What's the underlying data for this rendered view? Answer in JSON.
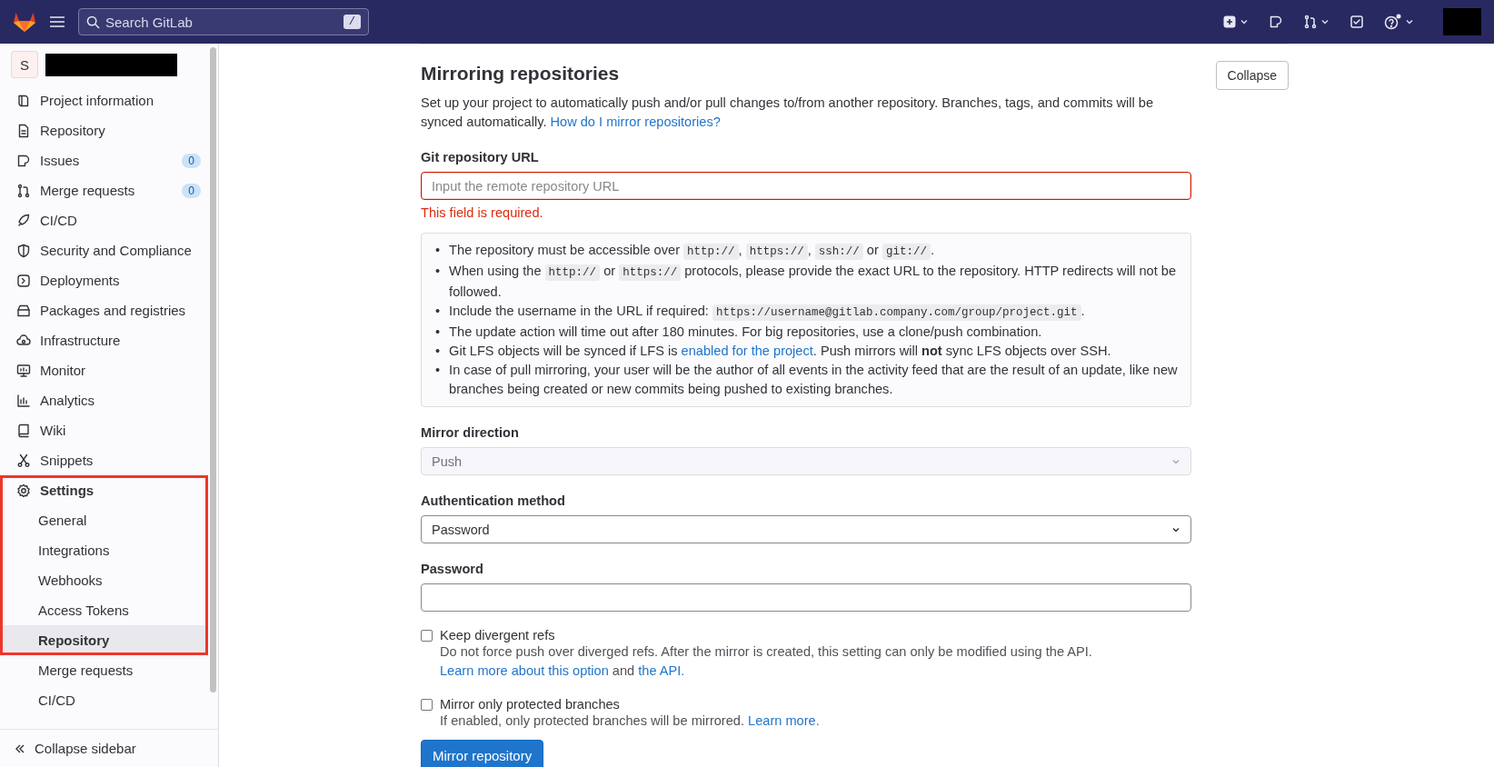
{
  "topbar": {
    "search": {
      "placeholder": "Search GitLab",
      "shortcut": "/"
    }
  },
  "sidebar": {
    "project_initial": "S",
    "items": [
      {
        "label": "Project information",
        "selected": false,
        "highlighted": false
      },
      {
        "label": "Repository",
        "selected": false,
        "highlighted": false
      },
      {
        "label": "Issues",
        "badge": "0",
        "selected": false,
        "highlighted": false
      },
      {
        "label": "Merge requests",
        "badge": "0",
        "selected": false,
        "highlighted": false
      },
      {
        "label": "CI/CD",
        "selected": false,
        "highlighted": false
      },
      {
        "label": "Security and Compliance",
        "selected": false,
        "highlighted": false
      },
      {
        "label": "Deployments",
        "selected": false,
        "highlighted": false
      },
      {
        "label": "Packages and registries",
        "selected": false,
        "highlighted": false
      },
      {
        "label": "Infrastructure",
        "selected": false,
        "highlighted": false
      },
      {
        "label": "Monitor",
        "selected": false,
        "highlighted": false
      },
      {
        "label": "Analytics",
        "selected": false,
        "highlighted": false
      },
      {
        "label": "Wiki",
        "selected": false,
        "highlighted": false
      },
      {
        "label": "Snippets",
        "selected": false,
        "highlighted": false
      },
      {
        "label": "Settings",
        "selected": false,
        "highlighted": true,
        "expanded": true,
        "children": [
          {
            "label": "General",
            "selected": false,
            "highlighted": true
          },
          {
            "label": "Integrations",
            "selected": false,
            "highlighted": true
          },
          {
            "label": "Webhooks",
            "selected": false,
            "highlighted": true
          },
          {
            "label": "Access Tokens",
            "selected": false,
            "highlighted": true
          },
          {
            "label": "Repository",
            "selected": true,
            "highlighted": true
          },
          {
            "label": "Merge requests",
            "selected": false,
            "highlighted": false
          },
          {
            "label": "CI/CD",
            "selected": false,
            "highlighted": false
          }
        ]
      }
    ],
    "collapse": "Collapse sidebar"
  },
  "section": {
    "title": "Mirroring repositories",
    "collapse_button": "Collapse",
    "intro": [
      {
        "kind": "text",
        "text": "Set up your project to automatically push and/or pull changes to/from another repository. Branches, tags, and commits will be synced automatically. "
      },
      {
        "kind": "link",
        "text": "How do I mirror repositories?"
      }
    ],
    "url_field": {
      "label": "Git repository URL",
      "placeholder": "Input the remote repository URL",
      "error": "This field is required."
    },
    "notes": [
      {
        "marker": "•",
        "segments": [
          {
            "kind": "text",
            "text": "The repository must be accessible over "
          },
          {
            "kind": "code",
            "text": "http://"
          },
          {
            "kind": "text",
            "text": ", "
          },
          {
            "kind": "code",
            "text": "https://"
          },
          {
            "kind": "text",
            "text": ", "
          },
          {
            "kind": "code",
            "text": "ssh://"
          },
          {
            "kind": "text",
            "text": " or "
          },
          {
            "kind": "code",
            "text": "git://"
          },
          {
            "kind": "text",
            "text": "."
          }
        ]
      },
      {
        "marker": "•",
        "segments": [
          {
            "kind": "text",
            "text": "When using the "
          },
          {
            "kind": "code",
            "text": "http://"
          },
          {
            "kind": "text",
            "text": " or "
          },
          {
            "kind": "code",
            "text": "https://"
          },
          {
            "kind": "text",
            "text": " protocols, please provide the exact URL to the repository. HTTP redirects will not be followed."
          }
        ]
      },
      {
        "marker": "•",
        "segments": [
          {
            "kind": "text",
            "text": "Include the username in the URL if required: "
          },
          {
            "kind": "code",
            "text": "https://username@gitlab.company.com/group/project.git"
          },
          {
            "kind": "text",
            "text": "."
          }
        ]
      },
      {
        "marker": "•",
        "segments": [
          {
            "kind": "text",
            "text": "The update action will time out after 180 minutes. For big repositories, use a clone/push combination."
          }
        ]
      },
      {
        "marker": "•",
        "segments": [
          {
            "kind": "text",
            "text": "Git LFS objects will be synced if LFS is "
          },
          {
            "kind": "link",
            "text": "enabled for the project"
          },
          {
            "kind": "text",
            "text": ". Push mirrors will "
          },
          {
            "kind": "bold",
            "text": "not"
          },
          {
            "kind": "text",
            "text": " sync LFS objects over SSH."
          }
        ]
      },
      {
        "marker": "•",
        "segments": [
          {
            "kind": "text",
            "text": "In case of pull mirroring, your user will be the author of all events in the activity feed that are the result of an update, like new branches being created or new commits being pushed to existing branches."
          }
        ]
      }
    ],
    "direction": {
      "label": "Mirror direction",
      "value": "Push",
      "disabled": true
    },
    "auth": {
      "label": "Authentication method",
      "value": "Password",
      "disabled": false
    },
    "password": {
      "label": "Password"
    },
    "options": [
      {
        "label": "Keep divergent refs",
        "checked": false,
        "help": [
          {
            "kind": "text",
            "text": "Do not force push over diverged refs. After the mirror is created, this setting can only be modified using the API. "
          },
          {
            "kind": "link",
            "text": "Learn more about this option"
          },
          {
            "kind": "text",
            "text": " and "
          },
          {
            "kind": "link",
            "text": "the API."
          }
        ]
      },
      {
        "label": "Mirror only protected branches",
        "checked": false,
        "help": [
          {
            "kind": "text",
            "text": "If enabled, only protected branches will be mirrored. "
          },
          {
            "kind": "link",
            "text": "Learn more."
          }
        ]
      }
    ],
    "submit": "Mirror repository"
  }
}
